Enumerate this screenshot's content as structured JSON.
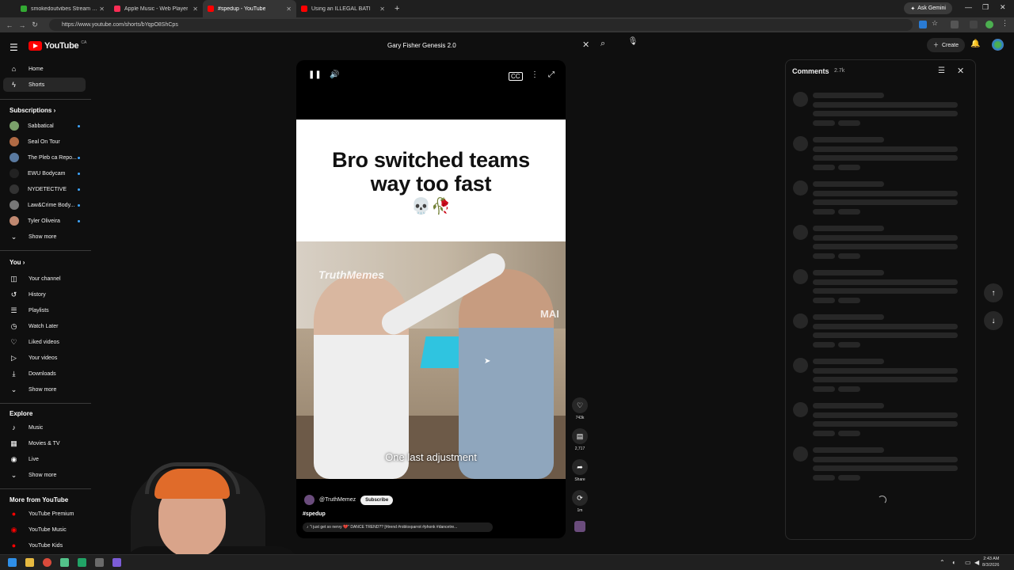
{
  "browser": {
    "tabs": [
      {
        "title": "smokedoutvibes Stream - Watc",
        "color": "#33aa33"
      },
      {
        "title": "Apple Music - Web Player",
        "color": "#fa2d55"
      },
      {
        "title": "#spedup - YouTube",
        "color": "#ff0000"
      },
      {
        "title": "Using an ILLEGAL BATI",
        "color": "#ff0000"
      }
    ],
    "new_tab": "+",
    "gemini_label": "Ask Gemini",
    "url": "https://www.youtube.com/shorts/bYqpO8ShCps"
  },
  "header": {
    "logo_text": "YouTube",
    "logo_country": "CA",
    "search_value": "Gary Fisher Genesis 2.0",
    "create_label": "Create"
  },
  "sidebar": {
    "main": [
      {
        "label": "Home",
        "icon": "home-icon",
        "glyph": "⌂"
      },
      {
        "label": "Shorts",
        "icon": "shorts-icon",
        "glyph": "ϟ"
      }
    ],
    "subscriptions_heading": "Subscriptions",
    "subscriptions": [
      {
        "label": "Sabbatical",
        "color": "#7aa06a"
      },
      {
        "label": "Seal On Tour",
        "color": "#b06a44"
      },
      {
        "label": "The Pleb ca Repo...",
        "color": "#5a7aa0"
      },
      {
        "label": "EWU Bodycam",
        "color": "#222222"
      },
      {
        "label": "NYDETECTIVE",
        "color": "#333333"
      },
      {
        "label": "Law&Crime Body...",
        "color": "#777777"
      },
      {
        "label": "Tyler Oliveira",
        "color": "#c08870"
      }
    ],
    "show_more": "Show more",
    "you_heading": "You",
    "you": [
      {
        "label": "Your channel",
        "glyph": "◫"
      },
      {
        "label": "History",
        "glyph": "↺"
      },
      {
        "label": "Playlists",
        "glyph": "☰"
      },
      {
        "label": "Watch Later",
        "glyph": "◷"
      },
      {
        "label": "Liked videos",
        "glyph": "♡"
      },
      {
        "label": "Your videos",
        "glyph": "▷"
      },
      {
        "label": "Downloads",
        "glyph": "⤓"
      }
    ],
    "explore_heading": "Explore",
    "explore": [
      {
        "label": "Music",
        "glyph": "♪"
      },
      {
        "label": "Movies & TV",
        "glyph": "▦"
      },
      {
        "label": "Live",
        "glyph": "◉"
      }
    ],
    "more_heading": "More from YouTube",
    "more": [
      {
        "label": "YouTube Premium"
      },
      {
        "label": "YouTube Music"
      },
      {
        "label": "YouTube Kids"
      }
    ]
  },
  "player": {
    "title_line1": "Bro switched teams",
    "title_line2": "way too fast",
    "emojis": "💀🥀",
    "watermark": "TruthMemes",
    "watermark_right": "MAI",
    "caption": "One last adjustment",
    "channel": "@TruthMemez",
    "subscribe_label": "Subscribe",
    "hashtag": "#spedup",
    "music": "\"i just get so nervy 💔\" DANCE TREND?? [#trend #robloxparrot #phonk #dancetre..."
  },
  "actions": {
    "likes": "743k",
    "comments": "2,717",
    "share": "Share",
    "remix": "1m"
  },
  "comments": {
    "title": "Comments",
    "count": "2.7k"
  },
  "taskbar": {
    "time": "2:43 AM",
    "date": "8/3/2026"
  }
}
